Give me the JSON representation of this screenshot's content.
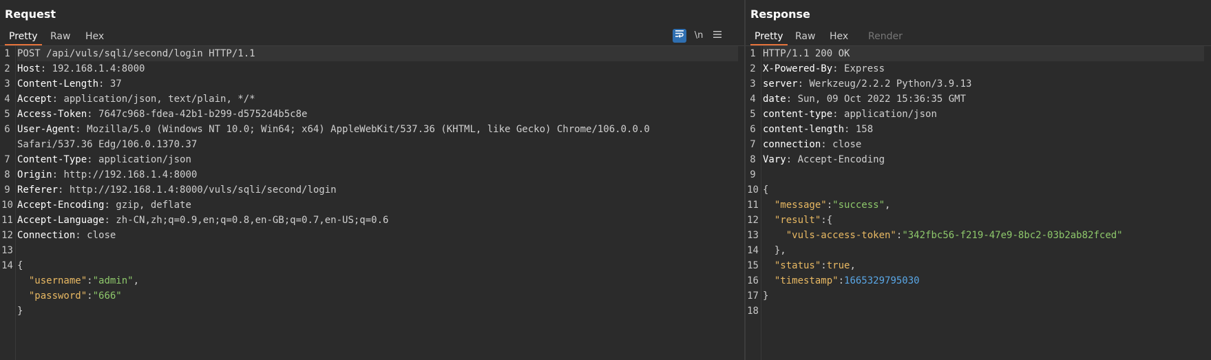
{
  "request": {
    "title": "Request",
    "tabs": [
      "Pretty",
      "Raw",
      "Hex"
    ],
    "active_tab": "Pretty",
    "tools": {
      "wrap_icon": "wrap-lines-icon",
      "newline_label": "\\n",
      "menu_icon": "hamburger-menu-icon"
    },
    "lines": [
      {
        "n": "1",
        "type": "plain",
        "text": "POST /api/vuls/sqli/second/login HTTP/1.1"
      },
      {
        "n": "2",
        "type": "header",
        "key": "Host",
        "value": "192.168.1.4:8000"
      },
      {
        "n": "3",
        "type": "header",
        "key": "Content-Length",
        "value": "37"
      },
      {
        "n": "4",
        "type": "header",
        "key": "Accept",
        "value": "application/json, text/plain, */*"
      },
      {
        "n": "5",
        "type": "header",
        "key": "Access-Token",
        "value": "7647c968-fdea-42b1-b299-d5752d4b5c8e"
      },
      {
        "n": "6",
        "type": "header",
        "key": "User-Agent",
        "value": "Mozilla/5.0 (Windows NT 10.0; Win64; x64) AppleWebKit/537.36 (KHTML, like Gecko) Chrome/106.0.0.0"
      },
      {
        "n": "",
        "type": "plain",
        "text": "Safari/537.36 Edg/106.0.1370.37"
      },
      {
        "n": "7",
        "type": "header",
        "key": "Content-Type",
        "value": "application/json"
      },
      {
        "n": "8",
        "type": "header",
        "key": "Origin",
        "value": "http://192.168.1.4:8000"
      },
      {
        "n": "9",
        "type": "header",
        "key": "Referer",
        "value": "http://192.168.1.4:8000/vuls/sqli/second/login"
      },
      {
        "n": "10",
        "type": "header",
        "key": "Accept-Encoding",
        "value": "gzip, deflate"
      },
      {
        "n": "11",
        "type": "header",
        "key": "Accept-Language",
        "value": "zh-CN,zh;q=0.9,en;q=0.8,en-GB;q=0.7,en-US;q=0.6"
      },
      {
        "n": "12",
        "type": "header",
        "key": "Connection",
        "value": "close"
      },
      {
        "n": "13",
        "type": "plain",
        "text": ""
      },
      {
        "n": "14",
        "type": "plain",
        "text": "{"
      },
      {
        "n": "",
        "type": "json",
        "indent": "  ",
        "key": "\"username\"",
        "value": "\"admin\"",
        "vtype": "str",
        "tail": ","
      },
      {
        "n": "",
        "type": "json",
        "indent": "  ",
        "key": "\"password\"",
        "value": "\"666\"",
        "vtype": "str",
        "tail": ""
      },
      {
        "n": "",
        "type": "plain",
        "text": "}"
      }
    ]
  },
  "response": {
    "title": "Response",
    "tabs": [
      "Pretty",
      "Raw",
      "Hex",
      "Render"
    ],
    "active_tab": "Pretty",
    "lines": [
      {
        "n": "1",
        "type": "plain",
        "text": "HTTP/1.1 200 OK"
      },
      {
        "n": "2",
        "type": "header",
        "key": "X-Powered-By",
        "value": "Express"
      },
      {
        "n": "3",
        "type": "header",
        "key": "server",
        "value": "Werkzeug/2.2.2 Python/3.9.13"
      },
      {
        "n": "4",
        "type": "header",
        "key": "date",
        "value": "Sun, 09 Oct 2022 15:36:35 GMT"
      },
      {
        "n": "5",
        "type": "header",
        "key": "content-type",
        "value": "application/json"
      },
      {
        "n": "6",
        "type": "header",
        "key": "content-length",
        "value": "158"
      },
      {
        "n": "7",
        "type": "header",
        "key": "connection",
        "value": "close"
      },
      {
        "n": "8",
        "type": "header",
        "key": "Vary",
        "value": "Accept-Encoding"
      },
      {
        "n": "9",
        "type": "plain",
        "text": ""
      },
      {
        "n": "10",
        "type": "plain",
        "text": "{"
      },
      {
        "n": "11",
        "type": "json",
        "indent": "  ",
        "key": "\"message\"",
        "value": "\"success\"",
        "vtype": "str",
        "tail": ","
      },
      {
        "n": "12",
        "type": "json",
        "indent": "  ",
        "key": "\"result\"",
        "value": "{",
        "vtype": "punct",
        "tail": ""
      },
      {
        "n": "13",
        "type": "json",
        "indent": "    ",
        "key": "\"vuls-access-token\"",
        "value": "\"342fbc56-f219-47e9-8bc2-03b2ab82fced\"",
        "vtype": "str",
        "tail": ""
      },
      {
        "n": "14",
        "type": "plain",
        "text": "  },"
      },
      {
        "n": "15",
        "type": "json",
        "indent": "  ",
        "key": "\"status\"",
        "value": "true",
        "vtype": "bool",
        "tail": ","
      },
      {
        "n": "16",
        "type": "json",
        "indent": "  ",
        "key": "\"timestamp\"",
        "value": "1665329795030",
        "vtype": "num",
        "tail": ""
      },
      {
        "n": "17",
        "type": "plain",
        "text": "}"
      },
      {
        "n": "18",
        "type": "plain",
        "text": ""
      }
    ]
  }
}
